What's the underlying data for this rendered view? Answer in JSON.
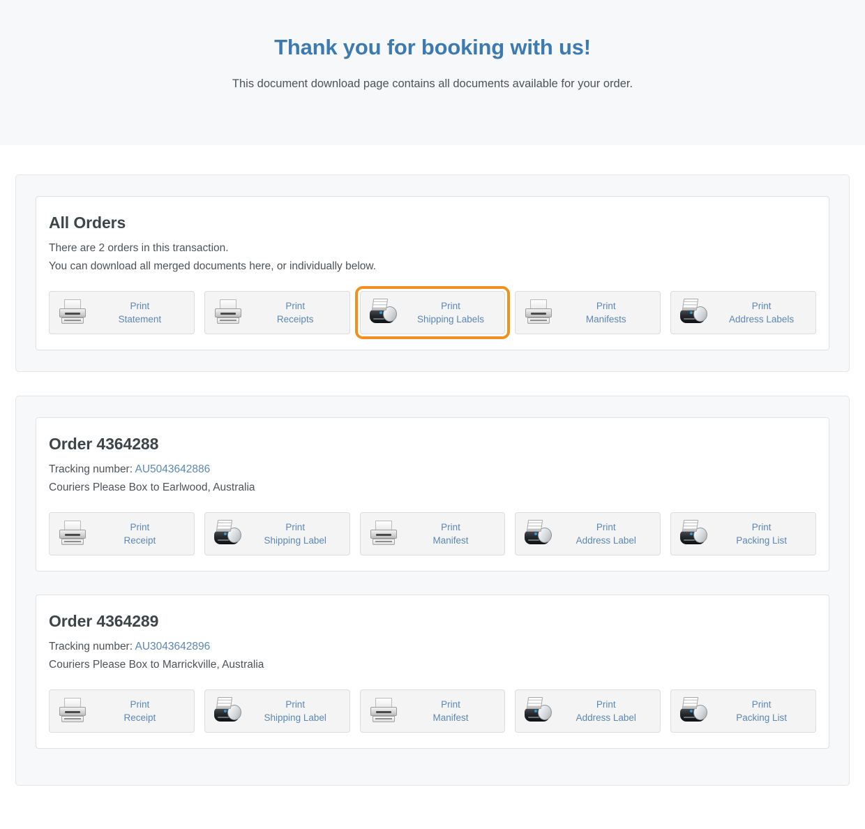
{
  "hero": {
    "title": "Thank you for booking with us!",
    "subtitle": "This document download page contains all documents available for your order."
  },
  "colors": {
    "accent_blue": "#3c7ab0",
    "link_blue": "#5b87b5",
    "highlight_orange": "#f0921e",
    "panel_bg": "#f7f8fa",
    "button_bg": "#f4f4f4"
  },
  "all_orders": {
    "title": "All Orders",
    "line1": "There are 2 orders in this transaction.",
    "line2": "You can download all merged documents here, or individually below.",
    "buttons": [
      {
        "line1": "Print",
        "line2": "Statement",
        "icon": "printer-icon",
        "highlighted": false
      },
      {
        "line1": "Print",
        "line2": "Receipts",
        "icon": "printer-icon",
        "highlighted": false
      },
      {
        "line1": "Print",
        "line2": "Shipping Labels",
        "icon": "label-printer-icon",
        "highlighted": true
      },
      {
        "line1": "Print",
        "line2": "Manifests",
        "icon": "printer-icon",
        "highlighted": false
      },
      {
        "line1": "Print",
        "line2": "Address Labels",
        "icon": "label-printer-icon",
        "highlighted": false
      }
    ]
  },
  "orders": [
    {
      "title": "Order 4364288",
      "tracking_label": "Tracking number:",
      "tracking_number": "AU5043642886",
      "shipping_line": "Couriers Please Box to Earlwood, Australia",
      "buttons": [
        {
          "line1": "Print",
          "line2": "Receipt",
          "icon": "printer-icon",
          "highlighted": false
        },
        {
          "line1": "Print",
          "line2": "Shipping Label",
          "icon": "label-printer-icon",
          "highlighted": false
        },
        {
          "line1": "Print",
          "line2": "Manifest",
          "icon": "printer-icon",
          "highlighted": false
        },
        {
          "line1": "Print",
          "line2": "Address Label",
          "icon": "label-printer-icon",
          "highlighted": false
        },
        {
          "line1": "Print",
          "line2": "Packing List",
          "icon": "label-printer-icon",
          "highlighted": false
        }
      ]
    },
    {
      "title": "Order 4364289",
      "tracking_label": "Tracking number:",
      "tracking_number": "AU3043642896",
      "shipping_line": "Couriers Please Box to Marrickville, Australia",
      "buttons": [
        {
          "line1": "Print",
          "line2": "Receipt",
          "icon": "printer-icon",
          "highlighted": false
        },
        {
          "line1": "Print",
          "line2": "Shipping Label",
          "icon": "label-printer-icon",
          "highlighted": false
        },
        {
          "line1": "Print",
          "line2": "Manifest",
          "icon": "printer-icon",
          "highlighted": false
        },
        {
          "line1": "Print",
          "line2": "Address Label",
          "icon": "label-printer-icon",
          "highlighted": false
        },
        {
          "line1": "Print",
          "line2": "Packing List",
          "icon": "label-printer-icon",
          "highlighted": false
        }
      ]
    }
  ]
}
